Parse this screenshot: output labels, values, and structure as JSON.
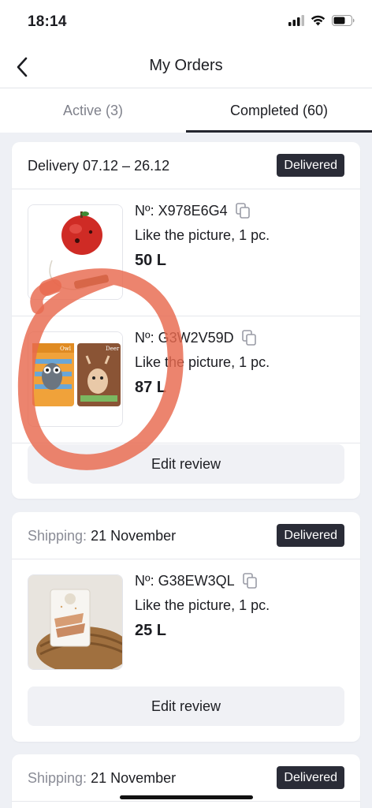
{
  "status_bar": {
    "time": "18:14"
  },
  "nav": {
    "title": "My Orders"
  },
  "tabs": [
    {
      "label": "Active (3)",
      "active": false
    },
    {
      "label": "Completed (60)",
      "active": true
    }
  ],
  "orders": [
    {
      "header_prefix": "",
      "header_text": "Delivery 07.12 – 26.12",
      "status": "Delivered",
      "items": [
        {
          "number_label": "Nº:",
          "number": "X978E6G4",
          "description": "Like the picture, 1 pc.",
          "price": "50 L"
        },
        {
          "number_label": "Nº:",
          "number": "G3W2V59D",
          "description": "Like the picture, 1 pc.",
          "price": "87 L"
        }
      ],
      "review_button": "Edit review"
    },
    {
      "header_prefix": "Shipping:",
      "header_text": "21 November",
      "status": "Delivered",
      "items": [
        {
          "number_label": "Nº:",
          "number": "G38EW3QL",
          "description": "Like the picture, 1 pc.",
          "price": "25 L"
        }
      ],
      "review_button": "Edit review"
    },
    {
      "header_prefix": "Shipping:",
      "header_text": "21 November",
      "status": "Delivered"
    }
  ],
  "thumbnail_texts": {
    "owl_label": "Owl",
    "deer_label": "Deer"
  },
  "colors": {
    "badge": "#2a2c37",
    "annotation": "#e8694e",
    "background": "#eef0f5"
  }
}
